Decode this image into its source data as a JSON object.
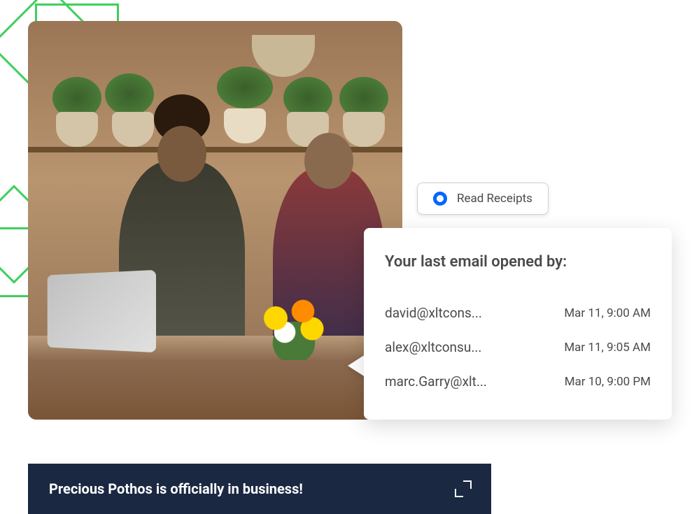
{
  "chip": {
    "label": "Read Receipts"
  },
  "panel": {
    "title": "Your last email opened by:",
    "rows": [
      {
        "email": "david@xltcons...",
        "time": "Mar 11, 9:00 AM"
      },
      {
        "email": "alex@xltconsu...",
        "time": "Mar 11, 9:05 AM"
      },
      {
        "email": "marc.Garry@xlt...",
        "time": "Mar 10, 9:00 PM"
      }
    ]
  },
  "banner": {
    "text": "Precious Pothos is officially in business!"
  }
}
